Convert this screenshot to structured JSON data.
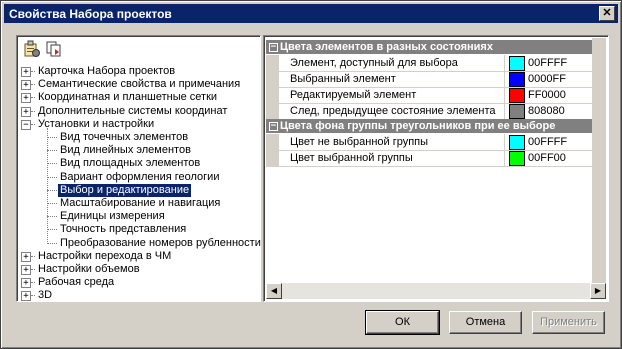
{
  "window": {
    "title": "Свойства Набора проектов",
    "close_label": "✕"
  },
  "toolbar": {
    "icons": [
      "properties-icon",
      "copy-settings-icon"
    ]
  },
  "tree": {
    "items": [
      {
        "label": "Карточка Набора проектов",
        "expander": "+"
      },
      {
        "label": "Семантические свойства и примечания",
        "expander": "+"
      },
      {
        "label": "Координатная и планшетные сетки",
        "expander": "+"
      },
      {
        "label": "Дополнительные системы координат",
        "expander": "+"
      },
      {
        "label": "Установки и настройки",
        "expander": "−"
      },
      {
        "label": "Вид точечных элементов"
      },
      {
        "label": "Вид линейных элементов"
      },
      {
        "label": "Вид площадных элементов"
      },
      {
        "label": "Вариант оформления геологии"
      },
      {
        "label": "Выбор и редактирование",
        "selected": true
      },
      {
        "label": "Масштабирование и навигация"
      },
      {
        "label": "Единицы измерения"
      },
      {
        "label": "Точность представления"
      },
      {
        "label": "Преобразование номеров рубленности"
      },
      {
        "label": "Настройки перехода в ЧМ",
        "expander": "+"
      },
      {
        "label": "Настройки объемов",
        "expander": "+"
      },
      {
        "label": "Рабочая среда",
        "expander": "+"
      },
      {
        "label": "3D",
        "expander": "+"
      }
    ]
  },
  "properties": {
    "categories": [
      {
        "title": "Цвета элементов в разных состояниях",
        "expander": "−",
        "rows": [
          {
            "name": "Элемент, доступный для выбора",
            "value": "00FFFF",
            "color": "#00FFFF"
          },
          {
            "name": "Выбранный элемент",
            "value": "0000FF",
            "color": "#0000FF"
          },
          {
            "name": "Редактируемый элемент",
            "value": "FF0000",
            "color": "#FF0000"
          },
          {
            "name": "След, предыдущее состояние элемента",
            "value": "808080",
            "color": "#808080"
          }
        ]
      },
      {
        "title": "Цвета фона группы треугольников при ее выборе",
        "expander": "−",
        "rows": [
          {
            "name": "Цвет не выбранной группы",
            "value": "00FFFF",
            "color": "#00FFFF"
          },
          {
            "name": "Цвет выбранной группы",
            "value": "00FF00",
            "color": "#00FF00"
          }
        ]
      }
    ]
  },
  "buttons": {
    "ok": "ОК",
    "cancel": "Отмена",
    "apply": "Применить"
  }
}
